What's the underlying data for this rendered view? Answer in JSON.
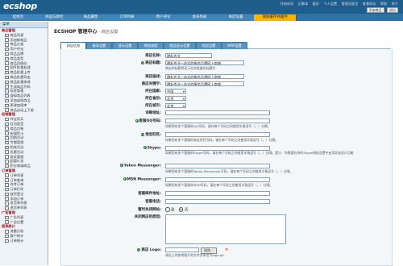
{
  "header": {
    "logo": "ecshop",
    "links": [
      "开始向导",
      "记事本",
      "缓存",
      "个人设置",
      "管理员留言",
      "查看网店",
      "帮助",
      "关于"
    ],
    "buttons": [
      "添加商品",
      "退出"
    ]
  },
  "nav": {
    "tabs": [
      "起始页",
      "商品与新栏",
      "商品属性",
      "订单列表",
      "用户评论",
      "会员列表",
      "商店设置",
      "清除缓存共插件"
    ],
    "active_index": 7
  },
  "sidebar": {
    "title": "菜单",
    "items": [
      {
        "label": "商品管理",
        "type": "group"
      },
      {
        "label": "商品列表",
        "type": "leaf"
      },
      {
        "label": "添加新商品",
        "type": "leaf"
      },
      {
        "label": "商品分类",
        "type": "leaf"
      },
      {
        "label": "用户评论",
        "type": "leaf"
      },
      {
        "label": "商品品牌",
        "type": "leaf"
      },
      {
        "label": "商品类型",
        "type": "leaf"
      },
      {
        "label": "商品回收站",
        "type": "leaf"
      },
      {
        "label": "图片批量处理",
        "type": "leaf"
      },
      {
        "label": "商品批量上传",
        "type": "leaf"
      },
      {
        "label": "商品批量导出",
        "type": "leaf"
      },
      {
        "label": "商品批量修改",
        "type": "leaf"
      },
      {
        "label": "生成商品代码",
        "type": "leaf"
      },
      {
        "label": "标签管理",
        "type": "leaf"
      },
      {
        "label": "虚拟商品列表",
        "type": "leaf"
      },
      {
        "label": "添加虚拟商品",
        "type": "leaf"
      },
      {
        "label": "更改加密串",
        "type": "leaf"
      },
      {
        "label": "商品自动上下架",
        "type": "leaf"
      },
      {
        "label": "促销管理",
        "type": "group"
      },
      {
        "label": "夺宝奇兵",
        "type": "leaf"
      },
      {
        "label": "红包类型",
        "type": "leaf"
      },
      {
        "label": "商品包装",
        "type": "leaf"
      },
      {
        "label": "祝福贺卡",
        "type": "leaf"
      },
      {
        "label": "团购活动",
        "type": "leaf"
      },
      {
        "label": "专题管理",
        "type": "leaf"
      },
      {
        "label": "拍卖活动",
        "type": "leaf"
      },
      {
        "label": "优惠活动",
        "type": "leaf"
      },
      {
        "label": "批发管理",
        "type": "leaf"
      },
      {
        "label": "超值礼包",
        "type": "leaf"
      },
      {
        "label": "积分商城商品",
        "type": "leaf"
      },
      {
        "label": "订单管理",
        "type": "group"
      },
      {
        "label": "订单列表",
        "type": "leaf"
      },
      {
        "label": "订单查询",
        "type": "leaf"
      },
      {
        "label": "合并订单",
        "type": "leaf"
      },
      {
        "label": "订单打印",
        "type": "leaf"
      },
      {
        "label": "缺货登记",
        "type": "leaf"
      },
      {
        "label": "添加订单",
        "type": "leaf"
      },
      {
        "label": "发货单列表",
        "type": "leaf"
      },
      {
        "label": "退货单列表",
        "type": "leaf"
      },
      {
        "label": "广告管理",
        "type": "group"
      },
      {
        "label": "广告列表",
        "type": "leaf"
      },
      {
        "label": "广告位置",
        "type": "leaf"
      },
      {
        "label": "报表统计",
        "type": "group"
      },
      {
        "label": "流量分析",
        "type": "leaf"
      },
      {
        "label": "客户统计",
        "type": "leaf"
      },
      {
        "label": "订单统计",
        "type": "leaf"
      }
    ]
  },
  "page": {
    "title_bold": "ECSHOP 管理中心",
    "title_sub": " - 商店设置"
  },
  "tabs": [
    "网店信息",
    "基本设置",
    "显示设置",
    "购物流程",
    "商品显示设置",
    "短信设置",
    "WAP设置"
  ],
  "form": {
    "shop_name": {
      "label": "商店名称:",
      "value": "耕耘农业"
    },
    "shop_title": {
      "label": "商店标题:",
      "value": "耕耘农业一站式的服务品牌网上商城",
      "hint": "商店的标题将显示在浏览器的标题栏"
    },
    "shop_desc": {
      "label": "商店描述:",
      "value": "耕耘农业一站式的服务品牌网上商城"
    },
    "shop_keywords": {
      "label": "商店关键字:",
      "value": "耕耘农业一站式的服务品牌网上商城"
    },
    "country": {
      "label": "所在国家:",
      "value": "中国"
    },
    "province": {
      "label": "所在省份:",
      "value": "北京"
    },
    "city": {
      "label": "所在城市:",
      "value": "北京"
    },
    "address": {
      "label": "详细地址:",
      "value": ""
    },
    "qq": {
      "label": "客服QQ号码:",
      "value": "",
      "hint": "如果您有多个客服的QQ号码，请在每个号码之间使用半角逗号（，）分隔。"
    },
    "taobao": {
      "label": "淘宝旺旺:",
      "value": "",
      "hint": "如果您有多个客服的淘宝旺旺号码，请在每个号码之间使用半角逗号（，）分隔。"
    },
    "skype": {
      "label": "Skype:",
      "value": "",
      "hint": "如果您有多个客服的Skype号码，请在每个号码之间使用半角逗号（，）分隔。提示：你需要在你的Skype隐私设置中启用状态显示功能"
    },
    "yahoo": {
      "label": "Yahoo Messenger:",
      "value": "",
      "hint": "如果您有多个客服的Yahoo Messenger号码，请在每个号码之间使用半角逗号（，）分隔。"
    },
    "msn": {
      "label": "MSN Messenger:",
      "value": "",
      "hint": "如果您有多个客服的MSN号码，请在每个号码之间使用半角逗号（，）分隔。"
    },
    "email": {
      "label": "客服邮件地址:",
      "value": ""
    },
    "phone": {
      "label": "客服电话:",
      "value": ""
    },
    "closed": {
      "label": "暂时关闭网站:",
      "options": [
        "是",
        "否"
      ],
      "selected": 1
    },
    "close_reason": {
      "label": "关闭网店的原因:",
      "value": ""
    },
    "logo": {
      "label": "商店 Logo:",
      "button": "浏览...",
      "hint": "请在上传前将图片的文件名命名为logo.gif"
    }
  }
}
